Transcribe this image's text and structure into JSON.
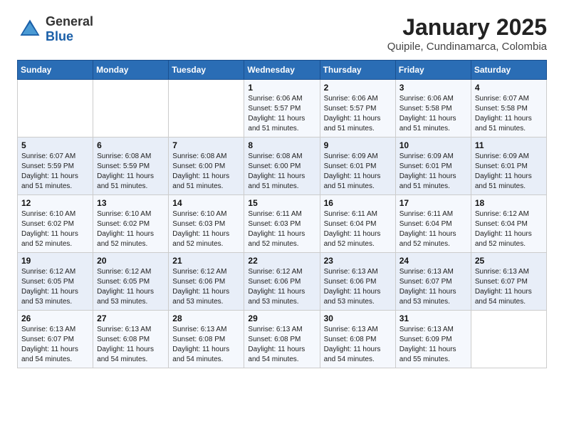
{
  "header": {
    "logo_general": "General",
    "logo_blue": "Blue",
    "month": "January 2025",
    "location": "Quipile, Cundinamarca, Colombia"
  },
  "weekdays": [
    "Sunday",
    "Monday",
    "Tuesday",
    "Wednesday",
    "Thursday",
    "Friday",
    "Saturday"
  ],
  "weeks": [
    [
      {
        "day": "",
        "info": ""
      },
      {
        "day": "",
        "info": ""
      },
      {
        "day": "",
        "info": ""
      },
      {
        "day": "1",
        "info": "Sunrise: 6:06 AM\nSunset: 5:57 PM\nDaylight: 11 hours\nand 51 minutes."
      },
      {
        "day": "2",
        "info": "Sunrise: 6:06 AM\nSunset: 5:57 PM\nDaylight: 11 hours\nand 51 minutes."
      },
      {
        "day": "3",
        "info": "Sunrise: 6:06 AM\nSunset: 5:58 PM\nDaylight: 11 hours\nand 51 minutes."
      },
      {
        "day": "4",
        "info": "Sunrise: 6:07 AM\nSunset: 5:58 PM\nDaylight: 11 hours\nand 51 minutes."
      }
    ],
    [
      {
        "day": "5",
        "info": "Sunrise: 6:07 AM\nSunset: 5:59 PM\nDaylight: 11 hours\nand 51 minutes."
      },
      {
        "day": "6",
        "info": "Sunrise: 6:08 AM\nSunset: 5:59 PM\nDaylight: 11 hours\nand 51 minutes."
      },
      {
        "day": "7",
        "info": "Sunrise: 6:08 AM\nSunset: 6:00 PM\nDaylight: 11 hours\nand 51 minutes."
      },
      {
        "day": "8",
        "info": "Sunrise: 6:08 AM\nSunset: 6:00 PM\nDaylight: 11 hours\nand 51 minutes."
      },
      {
        "day": "9",
        "info": "Sunrise: 6:09 AM\nSunset: 6:01 PM\nDaylight: 11 hours\nand 51 minutes."
      },
      {
        "day": "10",
        "info": "Sunrise: 6:09 AM\nSunset: 6:01 PM\nDaylight: 11 hours\nand 51 minutes."
      },
      {
        "day": "11",
        "info": "Sunrise: 6:09 AM\nSunset: 6:01 PM\nDaylight: 11 hours\nand 51 minutes."
      }
    ],
    [
      {
        "day": "12",
        "info": "Sunrise: 6:10 AM\nSunset: 6:02 PM\nDaylight: 11 hours\nand 52 minutes."
      },
      {
        "day": "13",
        "info": "Sunrise: 6:10 AM\nSunset: 6:02 PM\nDaylight: 11 hours\nand 52 minutes."
      },
      {
        "day": "14",
        "info": "Sunrise: 6:10 AM\nSunset: 6:03 PM\nDaylight: 11 hours\nand 52 minutes."
      },
      {
        "day": "15",
        "info": "Sunrise: 6:11 AM\nSunset: 6:03 PM\nDaylight: 11 hours\nand 52 minutes."
      },
      {
        "day": "16",
        "info": "Sunrise: 6:11 AM\nSunset: 6:04 PM\nDaylight: 11 hours\nand 52 minutes."
      },
      {
        "day": "17",
        "info": "Sunrise: 6:11 AM\nSunset: 6:04 PM\nDaylight: 11 hours\nand 52 minutes."
      },
      {
        "day": "18",
        "info": "Sunrise: 6:12 AM\nSunset: 6:04 PM\nDaylight: 11 hours\nand 52 minutes."
      }
    ],
    [
      {
        "day": "19",
        "info": "Sunrise: 6:12 AM\nSunset: 6:05 PM\nDaylight: 11 hours\nand 53 minutes."
      },
      {
        "day": "20",
        "info": "Sunrise: 6:12 AM\nSunset: 6:05 PM\nDaylight: 11 hours\nand 53 minutes."
      },
      {
        "day": "21",
        "info": "Sunrise: 6:12 AM\nSunset: 6:06 PM\nDaylight: 11 hours\nand 53 minutes."
      },
      {
        "day": "22",
        "info": "Sunrise: 6:12 AM\nSunset: 6:06 PM\nDaylight: 11 hours\nand 53 minutes."
      },
      {
        "day": "23",
        "info": "Sunrise: 6:13 AM\nSunset: 6:06 PM\nDaylight: 11 hours\nand 53 minutes."
      },
      {
        "day": "24",
        "info": "Sunrise: 6:13 AM\nSunset: 6:07 PM\nDaylight: 11 hours\nand 53 minutes."
      },
      {
        "day": "25",
        "info": "Sunrise: 6:13 AM\nSunset: 6:07 PM\nDaylight: 11 hours\nand 54 minutes."
      }
    ],
    [
      {
        "day": "26",
        "info": "Sunrise: 6:13 AM\nSunset: 6:07 PM\nDaylight: 11 hours\nand 54 minutes."
      },
      {
        "day": "27",
        "info": "Sunrise: 6:13 AM\nSunset: 6:08 PM\nDaylight: 11 hours\nand 54 minutes."
      },
      {
        "day": "28",
        "info": "Sunrise: 6:13 AM\nSunset: 6:08 PM\nDaylight: 11 hours\nand 54 minutes."
      },
      {
        "day": "29",
        "info": "Sunrise: 6:13 AM\nSunset: 6:08 PM\nDaylight: 11 hours\nand 54 minutes."
      },
      {
        "day": "30",
        "info": "Sunrise: 6:13 AM\nSunset: 6:08 PM\nDaylight: 11 hours\nand 54 minutes."
      },
      {
        "day": "31",
        "info": "Sunrise: 6:13 AM\nSunset: 6:09 PM\nDaylight: 11 hours\nand 55 minutes."
      },
      {
        "day": "",
        "info": ""
      }
    ]
  ]
}
